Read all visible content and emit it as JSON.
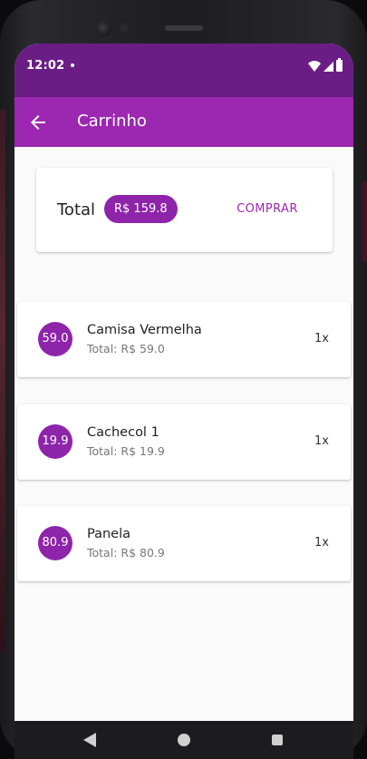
{
  "status_bar": {
    "time": "12:02"
  },
  "app_bar": {
    "title": "Carrinho",
    "back_icon": "arrow-left-icon"
  },
  "summary": {
    "total_label": "Total",
    "total_value": "R$ 159.8",
    "buy_label": "COMPRAR"
  },
  "cart": {
    "items": [
      {
        "price": "59.0",
        "name": "Camisa Vermelha",
        "subtotal": "Total: R$ 59.0",
        "quantity": "1x"
      },
      {
        "price": "19.9",
        "name": "Cachecol 1",
        "subtotal": "Total: R$ 19.9",
        "quantity": "1x"
      },
      {
        "price": "80.9",
        "name": "Panela",
        "subtotal": "Total: R$ 80.9",
        "quantity": "1x"
      }
    ]
  },
  "colors": {
    "status_bar": "#6b1d86",
    "app_bar": "#9c27b0",
    "accent": "#8e24aa"
  },
  "icons": {
    "status": [
      "wifi-icon",
      "signal-icon",
      "battery-icon"
    ],
    "navigation": [
      "nav-back-icon",
      "nav-home-icon",
      "nav-recents-icon"
    ]
  }
}
